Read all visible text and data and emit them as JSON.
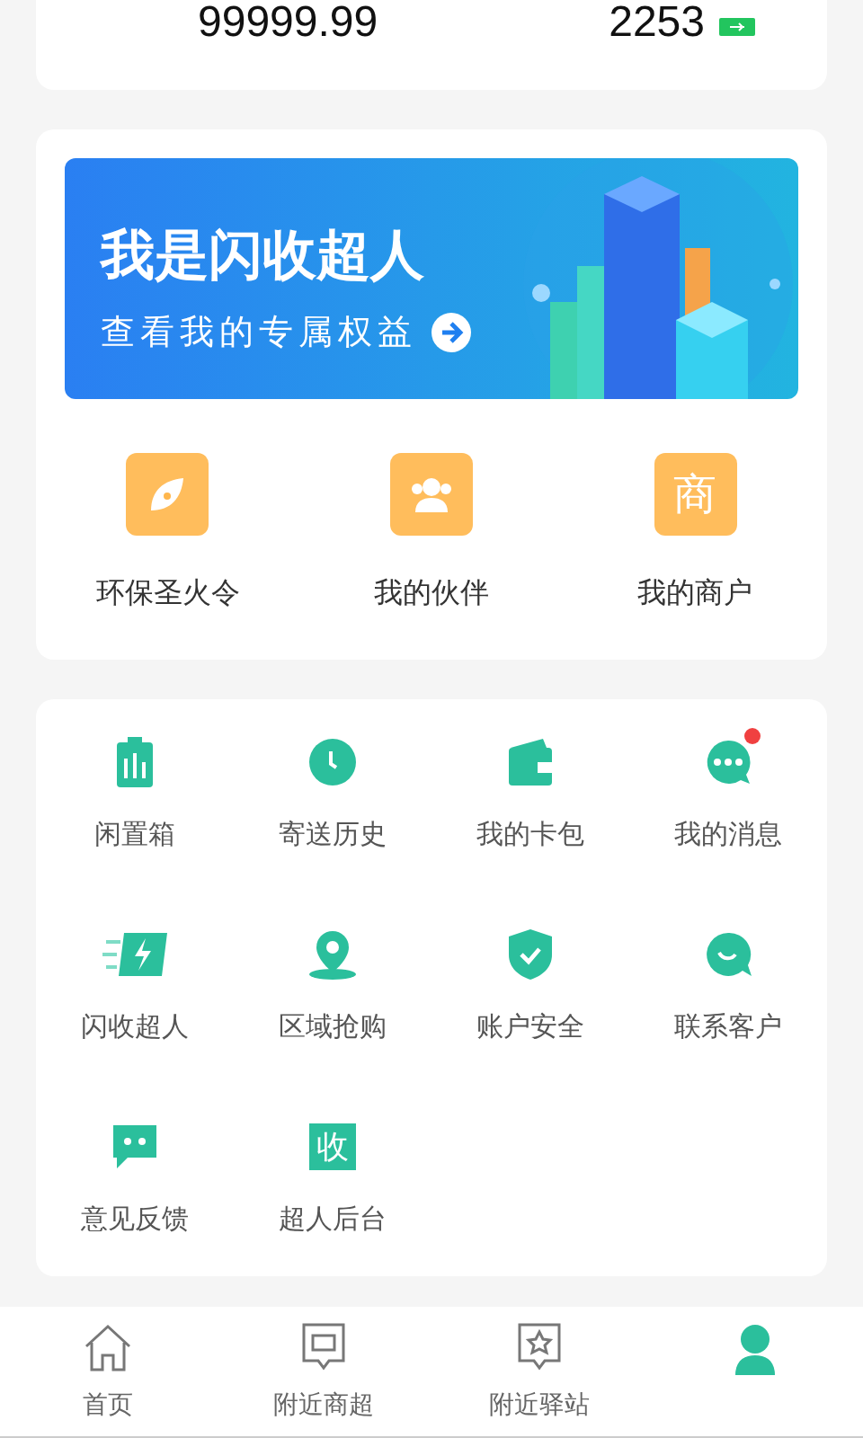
{
  "summary": {
    "amount": "99999.99",
    "count": "2253"
  },
  "banner": {
    "title": "我是闪收超人",
    "subtitle": "查看我的专属权益"
  },
  "features": [
    {
      "kind": "leaf",
      "label": "环保圣火令"
    },
    {
      "kind": "people",
      "label": "我的伙伴"
    },
    {
      "kind": "glyph",
      "glyph": "商",
      "label": "我的商户"
    }
  ],
  "services": [
    {
      "kind": "bin",
      "label": "闲置箱",
      "unread": false
    },
    {
      "kind": "clock",
      "label": "寄送历史",
      "unread": false
    },
    {
      "kind": "wallet",
      "label": "我的卡包",
      "unread": false
    },
    {
      "kind": "chat",
      "label": "我的消息",
      "unread": true
    },
    {
      "kind": "flash",
      "label": "闪收超人",
      "unread": false
    },
    {
      "kind": "pin",
      "label": "区域抢购",
      "unread": false
    },
    {
      "kind": "shield",
      "label": "账户安全",
      "unread": false
    },
    {
      "kind": "bubble",
      "label": "联系客户",
      "unread": false
    },
    {
      "kind": "feedback",
      "label": "意见反馈",
      "unread": false
    },
    {
      "kind": "glyph",
      "glyph": "收",
      "label": "超人后台",
      "unread": false
    }
  ],
  "tabs": [
    {
      "kind": "home",
      "label": "首页",
      "selected": false
    },
    {
      "kind": "shop",
      "label": "附近商超",
      "selected": false
    },
    {
      "kind": "station",
      "label": "附近驿站",
      "selected": false
    },
    {
      "kind": "person",
      "selected": true
    }
  ]
}
